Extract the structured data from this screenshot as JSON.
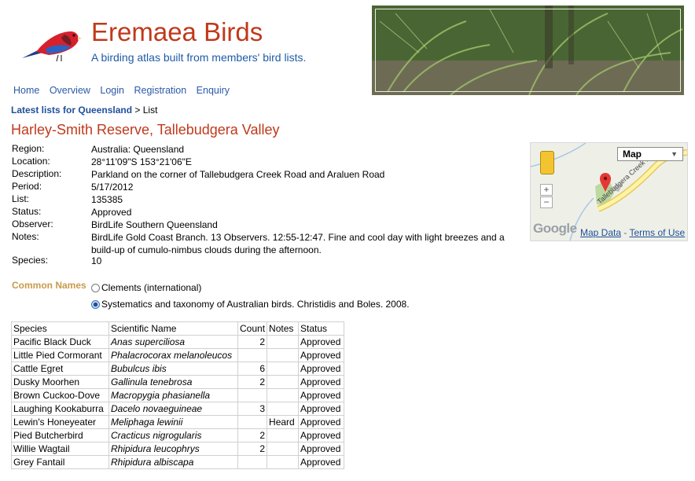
{
  "header": {
    "site_title": "Eremaea Birds",
    "tagline": "A birding atlas built from members' bird lists."
  },
  "nav": [
    "Home",
    "Overview",
    "Login",
    "Registration",
    "Enquiry"
  ],
  "breadcrumb": {
    "link": "Latest lists for Queensland",
    "current": "List"
  },
  "page_title": "Harley-Smith Reserve, Tallebudgera Valley",
  "details": [
    {
      "label": "Region:",
      "value": "Australia: Queensland"
    },
    {
      "label": "Location:",
      "value": "28°11'09\"S 153°21'06\"E"
    },
    {
      "label": "Description:",
      "value": "Parkland on the corner of Tallebudgera Creek Road and Araluen Road"
    },
    {
      "label": "Period:",
      "value": "5/17/2012"
    },
    {
      "label": "List:",
      "value": "135385"
    },
    {
      "label": "Status:",
      "value": "Approved"
    },
    {
      "label": "Observer:",
      "value": "BirdLife Southern Queensland"
    },
    {
      "label": "Notes:",
      "value": "BirdLife Gold Coast Branch. 13 Observers. 12:55-12:47. Fine and cool day with light breezes and a build-up of cumulo-nimbus clouds during the afternoon."
    },
    {
      "label": "Species:",
      "value": "10"
    }
  ],
  "map": {
    "type_selector": "Map",
    "road_label": "Tallebudgera Creek Ro",
    "google_logo": "Google",
    "map_data_link": "Map Data",
    "terms_link": "Terms of Use",
    "separator": "-"
  },
  "common_names": {
    "heading": "Common Names",
    "options": [
      {
        "label": "Clements (international)",
        "checked": false
      },
      {
        "label": "Systematics and taxonomy of Australian birds. Christidis and Boles. 2008.",
        "checked": true
      }
    ]
  },
  "table": {
    "headers": [
      "Species",
      "Scientific Name",
      "Count",
      "Notes",
      "Status"
    ],
    "rows": [
      [
        "Pacific Black Duck",
        "Anas superciliosa",
        "2",
        "",
        "Approved"
      ],
      [
        "Little Pied Cormorant",
        "Phalacrocorax melanoleucos",
        "",
        "",
        "Approved"
      ],
      [
        "Cattle Egret",
        "Bubulcus ibis",
        "6",
        "",
        "Approved"
      ],
      [
        "Dusky Moorhen",
        "Gallinula tenebrosa",
        "2",
        "",
        "Approved"
      ],
      [
        "Brown Cuckoo-Dove",
        "Macropygia phasianella",
        "",
        "",
        "Approved"
      ],
      [
        "Laughing Kookaburra",
        "Dacelo novaeguineae",
        "3",
        "",
        "Approved"
      ],
      [
        "Lewin's Honeyeater",
        "Meliphaga lewinii",
        "",
        "Heard",
        "Approved"
      ],
      [
        "Pied Butcherbird",
        "Cracticus nigrogularis",
        "2",
        "",
        "Approved"
      ],
      [
        "Willie Wagtail",
        "Rhipidura leucophrys",
        "2",
        "",
        "Approved"
      ],
      [
        "Grey Fantail",
        "Rhipidura albiscapa",
        "",
        "",
        "Approved"
      ]
    ]
  },
  "colors": {
    "title_red": "#c0391b",
    "link_blue": "#2a5aa8",
    "heading_gold": "#c99a4b"
  }
}
